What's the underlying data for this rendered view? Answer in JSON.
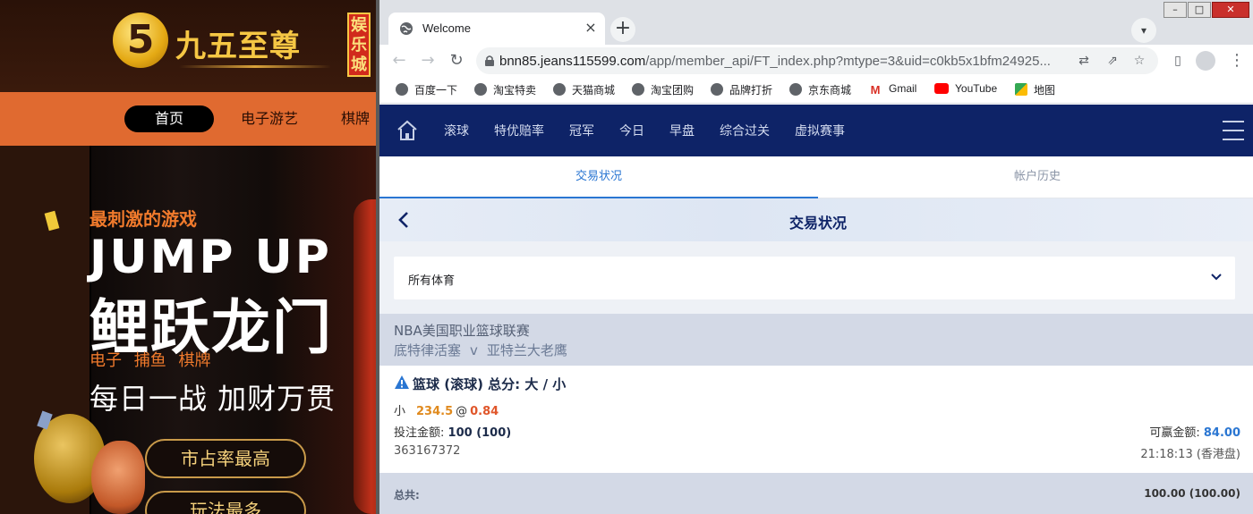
{
  "bg_site": {
    "logo_glyph": "5",
    "logo_name": "九五至尊",
    "logo_badge": "娱乐城",
    "nav": [
      "首页",
      "电子游艺",
      "棋牌"
    ],
    "tagline": "最刺激的游戏",
    "headline_en": "JUMP UP",
    "headline_cn": "鲤跃龙门",
    "categories": "电子 捕鱼 棋牌",
    "slogan": "每日一战 加财万贯",
    "pill_1": "市占率最高",
    "pill_2": "玩法最多"
  },
  "browser": {
    "tab_title": "Welcome",
    "tab_close": "×",
    "new_tab": "+",
    "url_host": "bnn85.jeans115599.com",
    "url_path": "/app/member_api/FT_index.php?mtype=3&uid=c0kb5x1bfm24925...",
    "bookmarks": [
      "百度一下",
      "淘宝特卖",
      "天猫商城",
      "淘宝团购",
      "品牌打折",
      "京东商城",
      "Gmail",
      "YouTube",
      "地图"
    ]
  },
  "app": {
    "nav_items": [
      "滚球",
      "特优赔率",
      "冠军",
      "今日",
      "早盘",
      "综合过关",
      "虚拟赛事"
    ],
    "subtabs": [
      "交易状况",
      "帐户历史"
    ],
    "page_title": "交易状况",
    "sport_filter": "所有体育",
    "league": "NBA美国职业篮球联赛",
    "home_team": "底特律活塞",
    "vs": "v",
    "away_team": "亚特兰大老鹰",
    "bet_type": "篮球 (滚球) 总分: 大 / 小",
    "selection": "小",
    "line": "234.5",
    "at": "@",
    "odds": "0.84",
    "stake_label": "投注金额:",
    "stake_value": "100 (100)",
    "win_label": "可赢金额:",
    "win_value": "84.00",
    "ticket_id": "363167372",
    "bet_time": "21:18:13 (香港盘)",
    "total_label": "总共:",
    "total_value": "100.00 (100.00)"
  },
  "colors": {
    "app_nav_bg": "#0e2367",
    "accent_blue": "#2a76d2",
    "odds_orange": "#e0562a",
    "line_orange": "#e08a1e",
    "bg_nav_orange": "#e06a30"
  }
}
